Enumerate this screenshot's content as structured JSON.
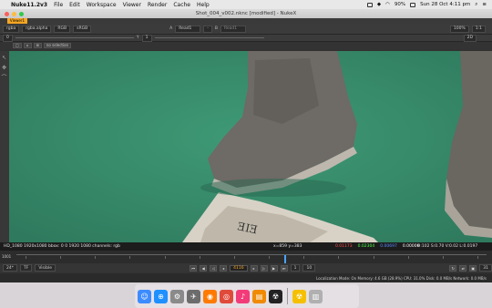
{
  "menubar": {
    "app_name": "Nuke11.2v3",
    "items": [
      "File",
      "Edit",
      "Workspace",
      "Viewer",
      "Render",
      "Cache",
      "Help"
    ],
    "battery": "90%",
    "clock": "Sun 28 Oct  4:11 pm"
  },
  "window": {
    "title": "Shot_004_v002.nknc [modified] - NukeX",
    "tab": "Viewer1"
  },
  "toolbar1": {
    "channels": "rgba",
    "alpha": "rgba.alpha",
    "display": "RGB",
    "colorspace": "sRGB",
    "input_a_label": "A",
    "input_a_value": "Read1",
    "separator": "-",
    "input_b_label": "B",
    "input_b_value": "Read1",
    "zoom": "100%",
    "ratio": "1:1",
    "view_mode": "2D"
  },
  "toolbar2": {
    "exposure": "0",
    "gamma_label": "Y",
    "gamma": "1"
  },
  "toolbar3": {
    "roi_label": "no selection"
  },
  "infobar": {
    "format": "HD_1080 1920x1080  bbox: 0 0 1920 1080  channels: rgb",
    "coords": "x=859 y=383",
    "r": "0.01173",
    "g": "0.02304",
    "b": "0.00697",
    "a": "0.00000",
    "hsv": "H:102 S:0.70 V:0.02  L:0.0197",
    "colors": {
      "r": "#ff4c4c",
      "g": "#4cff4c",
      "b": "#5a8cff",
      "a": "#ffffff"
    }
  },
  "timeline": {
    "start": "1001",
    "ticks": [
      "4084",
      "4090",
      "4095",
      "4100",
      "4105",
      "4110",
      "4115",
      "4120",
      "4125",
      "4130",
      "4135",
      "4140",
      "4145",
      "4150"
    ],
    "playhead": 0.57
  },
  "transport": {
    "fps_label": "24*",
    "tf_label": "TF",
    "visible_label": "Visible",
    "current_frame": "4116",
    "step": "1",
    "end_frame": "10",
    "last": "31"
  },
  "statusbar": {
    "text": "Localization Mode: On   Memory: 4.6 GB (28.9%)  CPU: 31.0%  Disk: 0.0 MB/s  Network: 0.0 MB/s"
  },
  "dock": {
    "apps": [
      {
        "name": "finder-icon",
        "color": "#3d8cff",
        "glyph": "☺"
      },
      {
        "name": "safari-icon",
        "color": "#1e90ff",
        "glyph": "⊕"
      },
      {
        "name": "settings-icon",
        "color": "#8a8a8a",
        "glyph": "⚙"
      },
      {
        "name": "launchpad-icon",
        "color": "#6c6c6c",
        "glyph": "✈"
      },
      {
        "name": "firefox-icon",
        "color": "#ff7a00",
        "glyph": "◉"
      },
      {
        "name": "chrome-icon",
        "color": "#e04a3a",
        "glyph": "◎"
      },
      {
        "name": "itunes-icon",
        "color": "#f23b78",
        "glyph": "♪"
      },
      {
        "name": "books-icon",
        "color": "#f08a00",
        "glyph": "▤"
      },
      {
        "name": "nuke-icon",
        "color": "#222222",
        "glyph": "☢"
      },
      {
        "name": "nukex-icon",
        "color": "#f5c000",
        "glyph": "☢"
      },
      {
        "name": "trash-icon",
        "color": "#b0b0b0",
        "glyph": "▥"
      }
    ]
  }
}
